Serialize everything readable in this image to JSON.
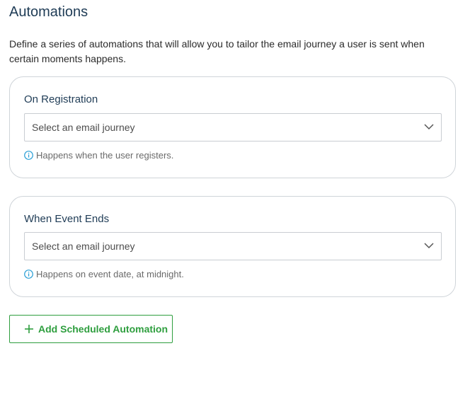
{
  "page": {
    "title": "Automations",
    "description": "Define a series of automations that will allow you to tailor the email journey a user is sent when certain moments happens."
  },
  "automations": [
    {
      "label": "On Registration",
      "select_placeholder": "Select an email journey",
      "hint": "Happens when the user registers."
    },
    {
      "label": "When Event Ends",
      "select_placeholder": "Select an email journey",
      "hint": "Happens on event date, at midnight."
    }
  ],
  "actions": {
    "add_label": "Add Scheduled Automation"
  },
  "icons": {
    "chevron": "chevron-down-icon",
    "info": "info-icon",
    "plus": "plus-icon"
  },
  "colors": {
    "heading": "#1f3c56",
    "accent_green": "#2e9e3e",
    "info_blue": "#2a9fd6",
    "border": "#cfd4d9"
  }
}
